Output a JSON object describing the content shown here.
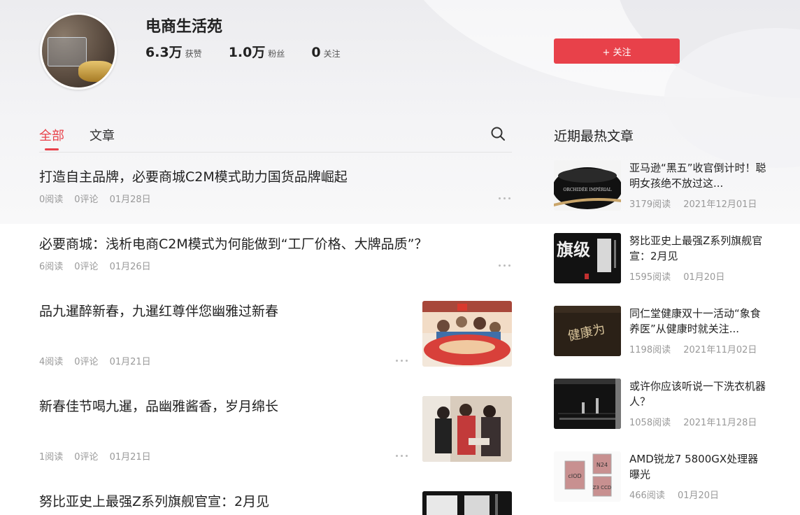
{
  "profile": {
    "name": "电商生活苑",
    "stats": [
      {
        "value": "6.3万",
        "label": "获赞"
      },
      {
        "value": "1.0万",
        "label": "粉丝"
      },
      {
        "value": "0",
        "label": "关注"
      }
    ],
    "follow_label": "+ 关注"
  },
  "tabs": [
    {
      "label": "全部",
      "active": true
    },
    {
      "label": "文章",
      "active": false
    }
  ],
  "articles": [
    {
      "title": "打造自主品牌，必要商城C2M模式助力国货品牌崛起",
      "reads": "0阅读",
      "comments": "0评论",
      "date": "01月28日"
    },
    {
      "title": "必要商城：浅析电商C2M模式为何能做到“工厂价格、大牌品质”？",
      "reads": "6阅读",
      "comments": "0评论",
      "date": "01月26日"
    },
    {
      "title": "品九暹醉新春，九暹红尊伴您幽雅过新春",
      "reads": "4阅读",
      "comments": "0评论",
      "date": "01月21日"
    },
    {
      "title": "新春佳节喝九暹，品幽雅酱香，岁月绵长",
      "reads": "1阅读",
      "comments": "0评论",
      "date": "01月21日"
    },
    {
      "title": "努比亚史上最强Z系列旗舰官宣：2月见"
    }
  ],
  "sidebar": {
    "title": "近期最热文章",
    "items": [
      {
        "title": "亚马逊“黑五”收官倒计时！聪明女孩绝不放过这...",
        "reads": "3179阅读",
        "date": "2021年12月01日",
        "thumb_text": "ORCHIDÉE IMPÉRIAL"
      },
      {
        "title": "努比亚史上最强Z系列旗舰官宣：2月见",
        "reads": "1595阅读",
        "date": "01月20日",
        "thumb_text": "旗级"
      },
      {
        "title": "同仁堂健康双十一活动“象食养医”从健康时就关注...",
        "reads": "1198阅读",
        "date": "2021年11月02日",
        "thumb_text": "健康为"
      },
      {
        "title": "或许你应该听说一下洗衣机器人？",
        "reads": "1058阅读",
        "date": "2021年11月28日"
      },
      {
        "title": "AMD锐龙7 5800GX处理器曝光",
        "reads": "466阅读",
        "date": "01月20日",
        "thumb_labels": [
          "cIOD",
          "N24",
          "Z3 CCD"
        ]
      }
    ]
  },
  "colors": {
    "accent": "#e8414a",
    "meta": "#999999"
  }
}
